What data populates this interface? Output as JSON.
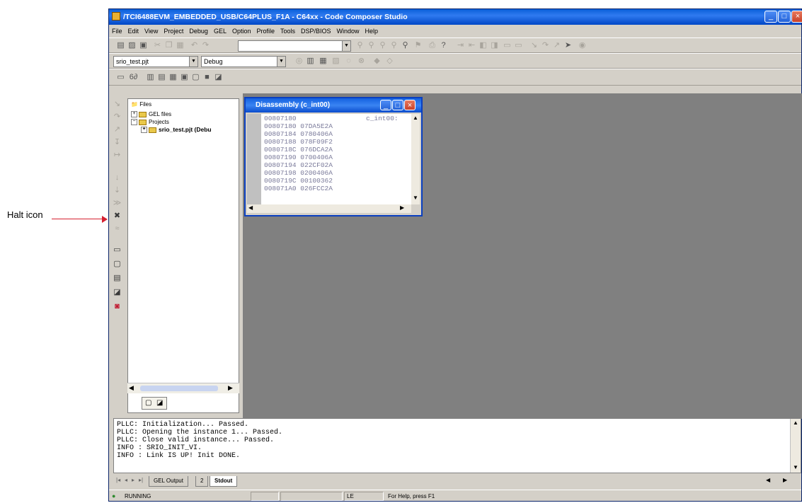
{
  "callout": {
    "label": "Halt icon"
  },
  "window": {
    "title": "/TCI6488EVM_EMBEDDED_USB/C64PLUS_F1A - C64xx - Code Composer Studio",
    "controls": [
      "_",
      "□",
      "×"
    ]
  },
  "menu": [
    "File",
    "Edit",
    "View",
    "Project",
    "Debug",
    "GEL",
    "Option",
    "Profile",
    "Tools",
    "DSP/BIOS",
    "Window",
    "Help"
  ],
  "toolbar2": {
    "project_select": "srio_test.pjt",
    "config_select": "Debug"
  },
  "project_tree": {
    "root": "Files",
    "items": [
      "GEL files",
      "Projects",
      "srio_test.pjt (Debu"
    ]
  },
  "disassembly": {
    "title": "Disassembly (c_int00)",
    "label": "c_int00:",
    "lines": [
      "00807180",
      "00807180 07DA5E2A",
      "00807184 0780406A",
      "00807188 078F09F2",
      "0080718C 076DCA2A",
      "00807190 0700406A",
      "00807194 022CF02A",
      "00807198 0200406A",
      "0080719C 00100362",
      "008071A0 026FCC2A"
    ]
  },
  "output": {
    "lines": [
      "PLLC: Initialization... Passed.",
      "PLLC: Opening the instance 1... Passed.",
      "PLLC: Close valid instance... Passed.",
      "INFO : SRIO_INIT_VI.",
      "INFO : Link IS UP! Init DONE."
    ],
    "tabs": [
      "GEL Output",
      "2",
      "Stdout"
    ]
  },
  "status": {
    "state": "RUNNING",
    "endian": "LE",
    "help": "For Help, press F1"
  },
  "colors": {
    "callout": "#d62030",
    "titlebar": "#0a5fd8",
    "mdi": "#808080"
  }
}
